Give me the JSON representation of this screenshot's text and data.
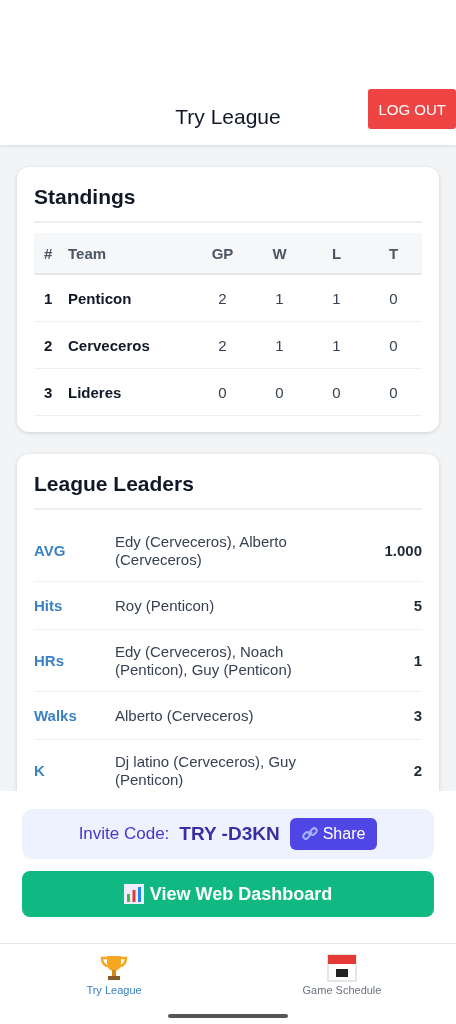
{
  "header": {
    "title": "Try League",
    "logout": "LOG OUT"
  },
  "standings": {
    "title": "Standings",
    "columns": [
      "#",
      "Team",
      "GP",
      "W",
      "L",
      "T"
    ],
    "rows": [
      [
        "1",
        "Penticon",
        "2",
        "1",
        "1",
        "0"
      ],
      [
        "2",
        "Cerveceros",
        "2",
        "1",
        "1",
        "0"
      ],
      [
        "3",
        "Lideres",
        "0",
        "0",
        "0",
        "0"
      ]
    ]
  },
  "leaders": {
    "title": "League Leaders",
    "rows": [
      {
        "stat": "AVG",
        "players": "Edy (Cerveceros), Alberto (Cerveceros)",
        "value": "1.000"
      },
      {
        "stat": "Hits",
        "players": "Roy (Penticon)",
        "value": "5"
      },
      {
        "stat": "HRs",
        "players": "Edy (Cerveceros), Noach (Penticon), Guy (Penticon)",
        "value": "1"
      },
      {
        "stat": "Walks",
        "players": "Alberto (Cerveceros)",
        "value": "3"
      },
      {
        "stat": "K",
        "players": "Dj latino (Cerveceros), Guy (Penticon)",
        "value": "2"
      }
    ]
  },
  "invite": {
    "label": "Invite Code:",
    "code": "TRY -D3KN",
    "share": "Share"
  },
  "dashboard_button": "View Web Dashboard",
  "tabs": [
    {
      "label": "Try League",
      "kind": "trophy",
      "selected": true
    },
    {
      "label": "Game Schedule",
      "kind": "calendar",
      "selected": false
    }
  ]
}
